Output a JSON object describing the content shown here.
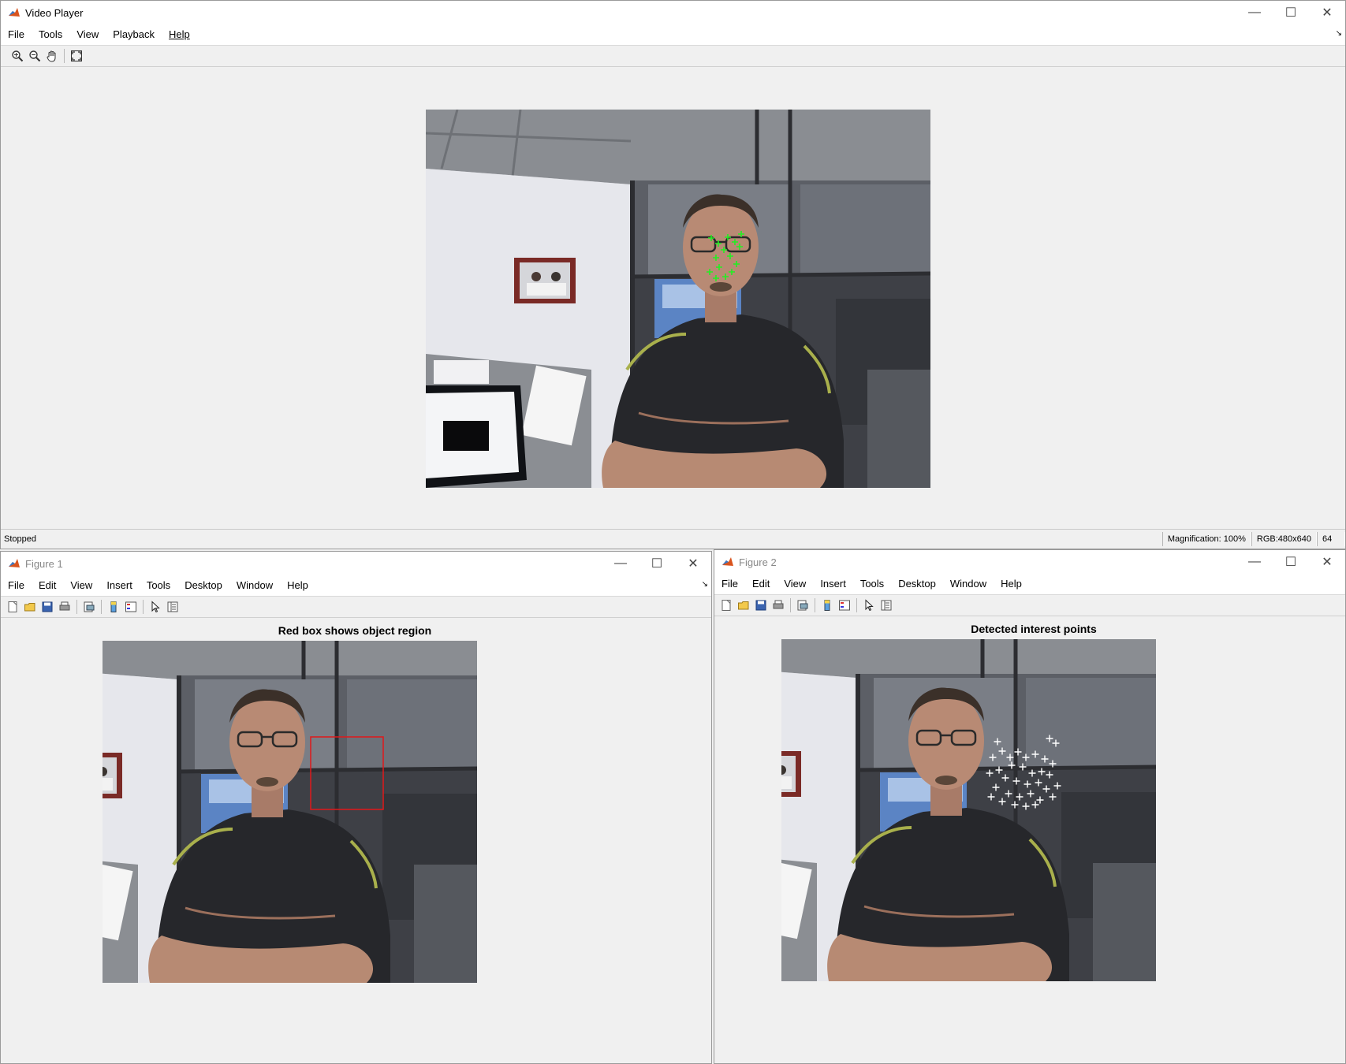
{
  "video_player": {
    "title": "Video Player",
    "menu": [
      "File",
      "Tools",
      "View",
      "Playback",
      "Help"
    ],
    "toolbar_icons": [
      "zoom-in-icon",
      "zoom-out-icon",
      "pan-hand-icon",
      "fit-to-window-icon"
    ],
    "status": "Stopped",
    "magnification": "Magnification: 100%",
    "rgb": "RGB:480x640",
    "frame": "64"
  },
  "figure1": {
    "title": "Figure 1",
    "menu": [
      "File",
      "Edit",
      "View",
      "Insert",
      "Tools",
      "Desktop",
      "Window",
      "Help"
    ],
    "axes_title": "Red box shows object region"
  },
  "figure2": {
    "title": "Figure 2",
    "menu": [
      "File",
      "Edit",
      "View",
      "Insert",
      "Tools",
      "Desktop",
      "Window",
      "Help"
    ],
    "axes_title": "Detected interest points"
  },
  "colors": {
    "tracked_points": "#22ee22",
    "object_box": "#e0191a",
    "interest_points": "#ffffff",
    "matlab_icon": "#d9541e"
  }
}
